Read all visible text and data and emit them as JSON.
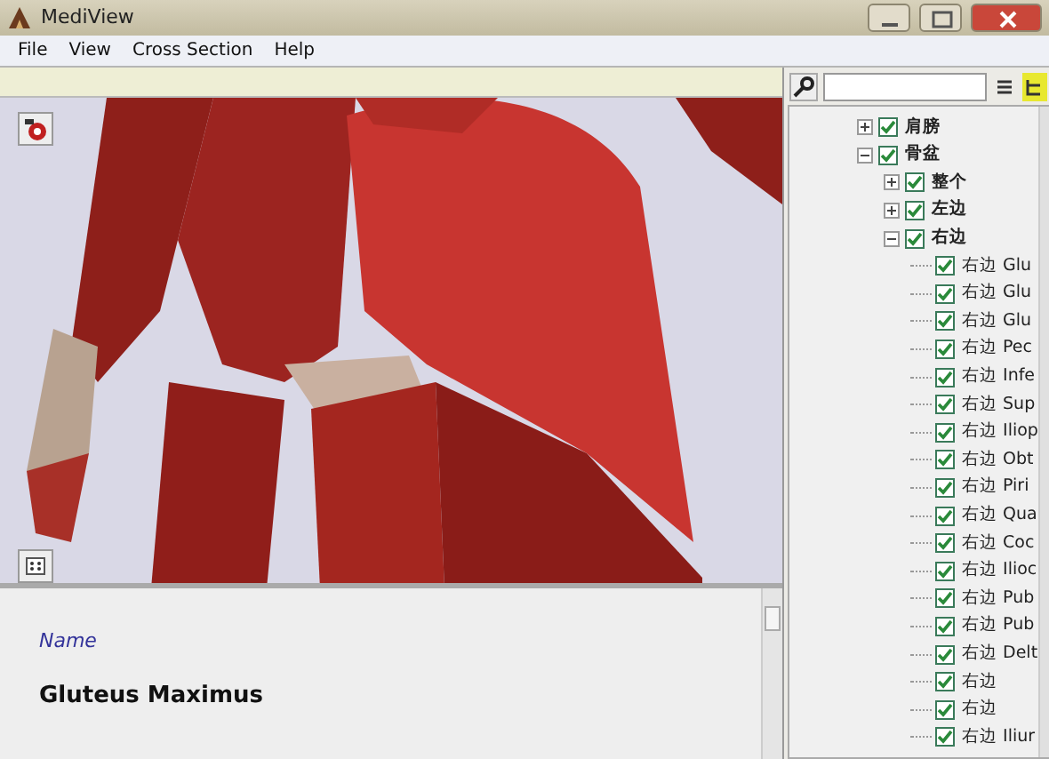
{
  "window": {
    "title": "MediView"
  },
  "menu": [
    "File",
    "View",
    "Cross Section",
    "Help"
  ],
  "detail": {
    "label": "Name",
    "value": "Gluteus Maximus"
  },
  "tree": [
    {
      "label": "肩膀",
      "checked": true,
      "expanded": false
    },
    {
      "label": "骨盆",
      "checked": true,
      "expanded": true,
      "children": [
        {
          "label": "整个",
          "checked": true,
          "expanded": false
        },
        {
          "label": "左边",
          "checked": true,
          "expanded": false
        },
        {
          "label": "右边",
          "checked": true,
          "expanded": true,
          "children": [
            {
              "label": "右边 Glu",
              "checked": true
            },
            {
              "label": "右边 Glu",
              "checked": true
            },
            {
              "label": "右边 Glu",
              "checked": true
            },
            {
              "label": "右边 Pec",
              "checked": true
            },
            {
              "label": "右边 Infe",
              "checked": true
            },
            {
              "label": "右边 Sup",
              "checked": true
            },
            {
              "label": "右边 Iliop",
              "checked": true
            },
            {
              "label": "右边 Obt",
              "checked": true
            },
            {
              "label": "右边 Piri",
              "checked": true
            },
            {
              "label": "右边 Qua",
              "checked": true
            },
            {
              "label": "右边 Coc",
              "checked": true
            },
            {
              "label": "右边 Ilioc",
              "checked": true
            },
            {
              "label": "右边 Pub",
              "checked": true
            },
            {
              "label": "右边 Pub",
              "checked": true
            },
            {
              "label": "右边 Delt",
              "checked": true
            },
            {
              "label": "右边",
              "checked": true
            },
            {
              "label": "右边",
              "checked": true
            },
            {
              "label": "右边 Iliur",
              "checked": true
            }
          ]
        }
      ]
    }
  ]
}
